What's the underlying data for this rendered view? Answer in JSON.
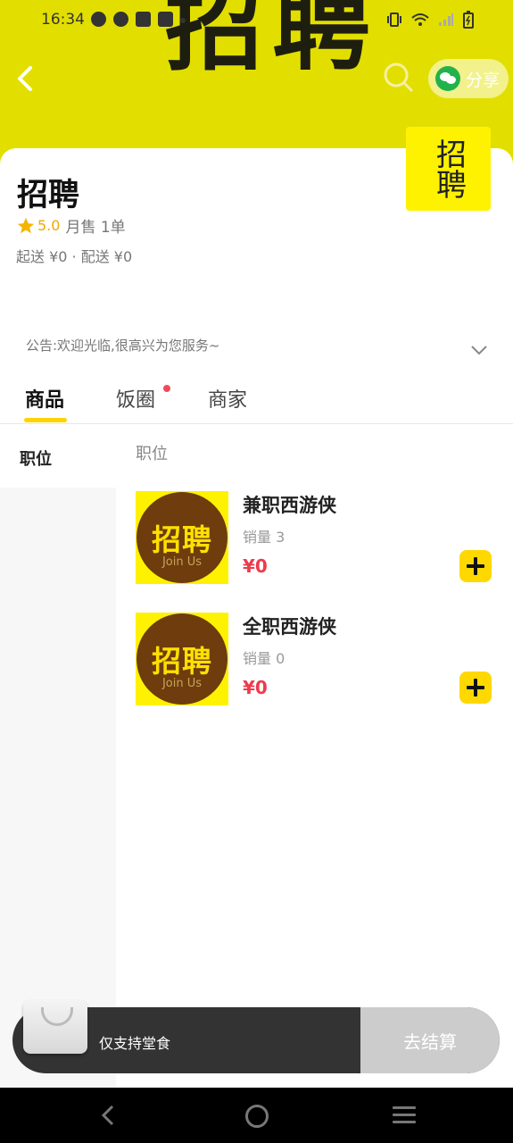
{
  "status_bar": {
    "time": "16:34"
  },
  "header": {
    "banner_text": "招聘",
    "share_label": "分享"
  },
  "store": {
    "name": "招聘",
    "logo_text": "招聘",
    "rating": "5.0",
    "monthly_sales": "月售 1单",
    "delivery": "起送 ¥0 · 配送 ¥0",
    "notice": "公告:欢迎光临,很高兴为您服务~"
  },
  "tabs": [
    {
      "label": "商品",
      "active": true
    },
    {
      "label": "饭圈",
      "has_dot": true
    },
    {
      "label": "商家"
    }
  ],
  "sidebar": {
    "items": [
      {
        "label": "职位"
      }
    ]
  },
  "section": {
    "title": "职位"
  },
  "products": [
    {
      "name": "兼职西游侠",
      "sales": "销量 3",
      "price": "¥0",
      "image_text": "招聘",
      "image_sub": "Join Us"
    },
    {
      "name": "全职西游侠",
      "sales": "销量 0",
      "price": "¥0",
      "image_text": "招聘",
      "image_sub": "Join Us"
    }
  ],
  "cart": {
    "note": "仅支持堂食",
    "checkout_label": "去结算"
  },
  "colors": {
    "accent": "#ffd800",
    "banner": "#e2df00",
    "price": "#ee3b4d",
    "rating": "#f2a900"
  }
}
